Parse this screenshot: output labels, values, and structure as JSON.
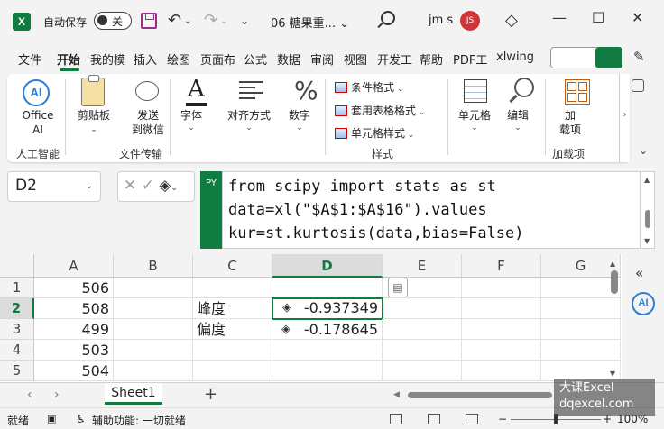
{
  "titlebar": {
    "logo": "X",
    "autosave_label": "自动保存",
    "autosave_state": "关",
    "doc_title": "06 糖果重... ⌄",
    "user_name": "jm s",
    "avatar_initials": "JS",
    "icons": [
      "save-icon",
      "undo-icon",
      "redo-icon",
      "search-icon",
      "diamond-icon",
      "minimize-icon",
      "maximize-icon",
      "close-icon"
    ]
  },
  "tabs": [
    "文件",
    "开始",
    "我的模",
    "插入",
    "绘图",
    "页面布",
    "公式",
    "数据",
    "审阅",
    "视图",
    "开发工",
    "帮助",
    "PDF工",
    "xlwing"
  ],
  "active_tab": "开始",
  "ribbon": {
    "ai_button": "Office\nAI",
    "ai_group": "人工智能",
    "clipboard": "剪贴板",
    "send_wechat": "发送\n到微信",
    "file_transfer_group": "文件传输",
    "font": "字体",
    "alignment": "对齐方式",
    "number": "数字",
    "conditional_format": "条件格式",
    "table_format": "套用表格格式",
    "cell_styles": "单元格样式",
    "styles_group": "样式",
    "cells": "单元格",
    "editing": "编辑",
    "addins": "加\n载项",
    "addins_group": "加载项"
  },
  "formula_bar": {
    "name_box": "D2",
    "badge": "PY",
    "lines": [
      "from scipy import stats as st",
      "data=xl(\"$A$1:$A$16\").values",
      "kur=st.kurtosis(data,bias=False)"
    ]
  },
  "grid": {
    "columns": [
      "A",
      "B",
      "C",
      "D",
      "E",
      "F",
      "G"
    ],
    "selected_column": "D",
    "rows": [
      "1",
      "2",
      "3",
      "4",
      "5"
    ],
    "selected_row": "2",
    "cells": {
      "A1": "506",
      "A2": "508",
      "A3": "499",
      "A4": "503",
      "A5": "504",
      "C2": "峰度",
      "C3": "偏度",
      "D2": "-0.937349",
      "D3": "-0.178645"
    },
    "active_cell": "D2"
  },
  "sheets": {
    "tabs": [
      "Sheet1"
    ],
    "active": "Sheet1"
  },
  "statusbar": {
    "ready": "就绪",
    "accessibility": "辅助功能: 一切就绪",
    "zoom": "100%"
  },
  "watermark": {
    "line1": "大课Excel",
    "line2": "dqexcel.com"
  },
  "colors": {
    "excel_green": "#107c41",
    "avatar_red": "#d13438",
    "ai_blue": "#2d7dd2"
  }
}
